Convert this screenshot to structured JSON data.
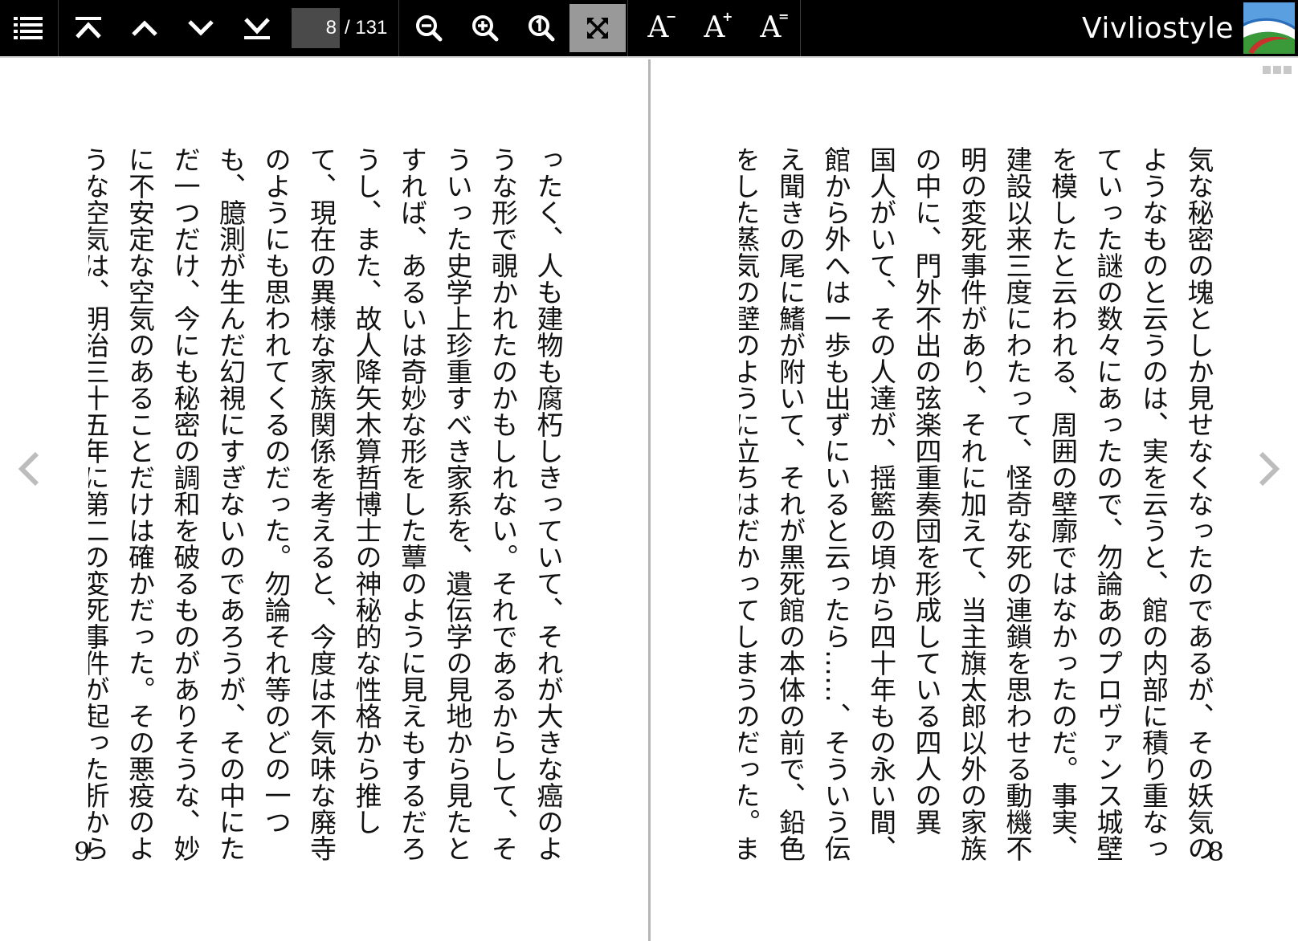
{
  "toolbar": {
    "page_current": "8",
    "page_total": "/ 131",
    "font_decrease_label": "A",
    "font_decrease_mark": "−",
    "font_increase_label": "A",
    "font_increase_mark": "+",
    "font_reset_label": "A",
    "font_reset_mark": "=",
    "brand_name": "Vivliostyle"
  },
  "icons": {
    "toc": "list-icon",
    "first_page": "first-page-icon",
    "prev_page": "chevron-up-icon",
    "next_page": "chevron-down-icon",
    "last_page": "last-page-icon",
    "zoom_out": "zoom-out-icon",
    "zoom_in": "zoom-in-icon",
    "zoom_actual": "zoom-actual-size-icon",
    "fit": "fit-to-screen-icon",
    "prev_spread": "chevron-left-icon",
    "next_spread": "chevron-right-icon",
    "more": "more-dots-icon"
  },
  "colors": {
    "toolbar_bg": "#000000",
    "active_button": "#999999",
    "page_input_bg": "#4a4a4a",
    "spine": "#b5b5b5"
  },
  "spread": {
    "left": {
      "page_number": "9",
      "text": "ったく、人も建物も腐朽しきっていて、それが大きな癌のよ\nうな形で覗かれたのかもしれない。それであるからして、そ\nういった史学上珍重すべき家系を、遺伝学の見地から見たと\nすれば、あるいは奇妙な形をした蕈のように見えもするだろ\nうし、また、故人降矢木算哲博士の神秘的な性格から推し\nて、現在の異様な家族関係を考えると、今度は不気味な廃寺\nのようにも思われてくるのだった。勿論それ等のどの一つ\nも、臆測が生んだ幻視にすぎないのであろうが、その中にた\nだ一つだけ、今にも秘密の調和を破るものがありそうな、妙\nに不安定な空気のあることだけは確かだった。その悪疫のよ\nうな空気は、明治三十五年に第二の変死事件が起った折から"
    },
    "right": {
      "page_number": "8",
      "text": "気な秘密の塊としか見せなくなったのであるが、その妖気の\nようなものと云うのは、実を云うと、館の内部に積り重なっ\nていった謎の数々にあったので、勿論あのプロヴァンス城壁\nを模したと云われる、周囲の壁廓ではなかったのだ。事実、\n建設以来三度にわたって、怪奇な死の連鎖を思わせる動機不\n明の変死事件があり、それに加えて、当主旗太郎以外の家族\nの中に、門外不出の弦楽四重奏団を形成している四人の異\n国人がいて、その人達が、揺籃の頃から四十年もの永い間、\n館から外へは一歩も出ずにいると云ったら……、そういう伝\nえ聞きの尾に鰭が附いて、それが黒死館の本体の前で、鉛色\nをした蒸気の壁のように立ちはだかってしまうのだった。ま"
    }
  }
}
